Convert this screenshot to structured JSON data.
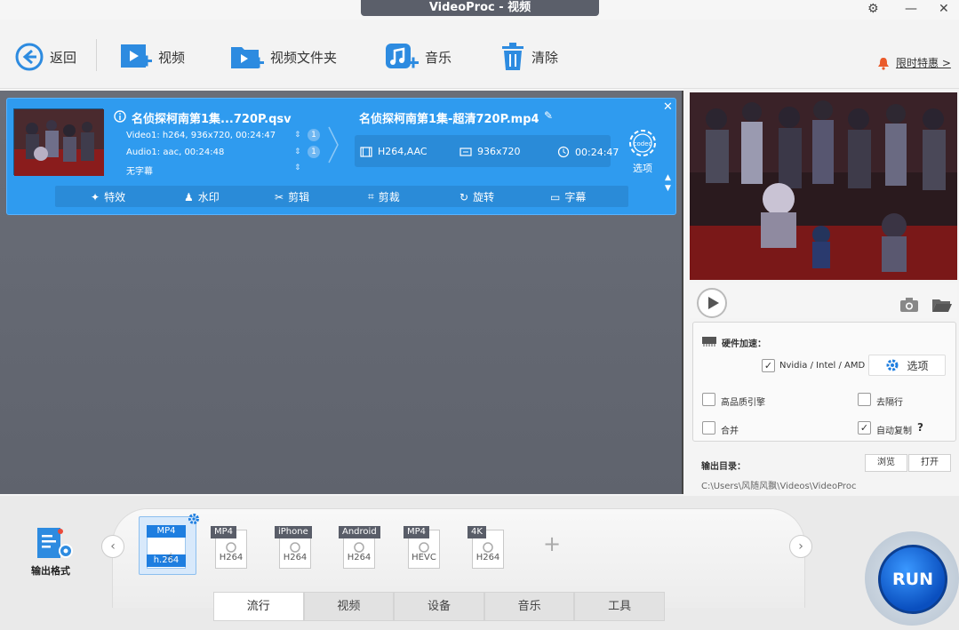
{
  "window": {
    "title": "VideoProc - 视频"
  },
  "toolbar": {
    "back_label": "返回",
    "video_label": "视频",
    "folder_label": "视频文件夹",
    "music_label": "音乐",
    "clear_label": "清除",
    "promo_label": "限时特惠 >"
  },
  "task": {
    "source_title": "名侦探柯南第1集...720P.qsv",
    "video_info": "Video1: h264, 936x720, 00:24:47",
    "audio_info": "Audio1: aac, 00:24:48",
    "subtitle_info": "无字幕",
    "badge1": "1",
    "badge2": "1",
    "output_title": "名侦探柯南第1集-超清720P.mp4",
    "out_codec": "H264,AAC",
    "out_resolution": "936x720",
    "out_duration": "00:24:47",
    "codec_icon_text": "codec",
    "codec_label": "选项",
    "tools": [
      "特效",
      "水印",
      "剪辑",
      "剪裁",
      "旋转",
      "字幕"
    ]
  },
  "settings": {
    "hw_accel_label": "硬件加速：",
    "gpu_label": "Nvidia / Intel / AMD",
    "options_label": "选项",
    "hq_engine_label": "高品质引擎",
    "deinterlace_label": "去隔行",
    "merge_label": "合并",
    "autocopy_label": "自动复制",
    "help_mark": "?"
  },
  "output": {
    "dir_label": "输出目录：",
    "browse_label": "浏览",
    "open_label": "打开",
    "path": "C:\\Users\\风随风飘\\Videos\\VideoProc"
  },
  "formats": {
    "output_format_label": "输出格式",
    "items": [
      {
        "tag": "MP4",
        "sub": "h.264"
      },
      {
        "tag": "MP4",
        "sub": "H264"
      },
      {
        "tag": "iPhone",
        "sub": "H264"
      },
      {
        "tag": "Android",
        "sub": "H264"
      },
      {
        "tag": "MP4",
        "sub": "HEVC"
      },
      {
        "tag": "4K",
        "sub": "H264"
      }
    ],
    "add_symbol": "+"
  },
  "tabs": [
    "流行",
    "视频",
    "设备",
    "音乐",
    "工具"
  ],
  "run_label": "RUN",
  "colors": {
    "accent": "#2f9bef",
    "run": "#1a6ee6",
    "workspace": "#636771"
  }
}
